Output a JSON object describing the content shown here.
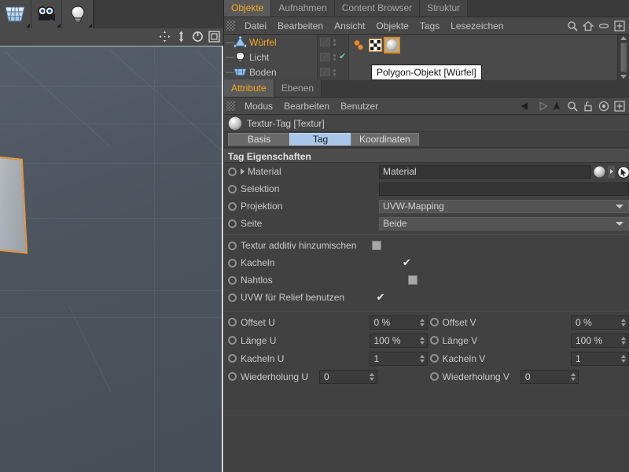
{
  "viewport": {
    "palette": [
      {
        "name": "floor-grid-icon",
        "label": "Boden"
      },
      {
        "name": "camera-icon",
        "label": "Kamera"
      },
      {
        "name": "light-bulb-icon",
        "label": "Licht"
      }
    ],
    "nav_icons": [
      "move-icon",
      "scale-icon",
      "rotate-icon",
      "viewport-maximize-icon"
    ],
    "selected_object": "Würfel"
  },
  "object_manager": {
    "tabs": [
      {
        "label": "Objekte",
        "active": true
      },
      {
        "label": "Aufnahmen",
        "active": false
      },
      {
        "label": "Content Browser",
        "active": false
      },
      {
        "label": "Struktur",
        "active": false
      }
    ],
    "menu": [
      "Datei",
      "Bearbeiten",
      "Ansicht",
      "Objekte",
      "Tags",
      "Lesezeichen"
    ],
    "menu_icons": [
      "search-icon",
      "home-icon",
      "eye-icon",
      "add-box-icon"
    ],
    "objects": [
      {
        "label": "Würfel",
        "icon": "cube-object-icon",
        "selected": true,
        "visible_check": false
      },
      {
        "label": "Licht",
        "icon": "light-object-icon",
        "selected": false,
        "visible_check": true
      },
      {
        "label": "Boden",
        "icon": "floor-object-icon",
        "selected": false,
        "visible_check": false
      }
    ],
    "tags": [
      {
        "name": "phong-tag-icon",
        "selected": false
      },
      {
        "name": "uv-checker-tag-icon",
        "selected": false
      },
      {
        "name": "texture-tag-icon",
        "selected": true
      }
    ],
    "tooltip": "Polygon-Objekt [Würfel]"
  },
  "attribute_manager": {
    "tabs": [
      {
        "label": "Attribute",
        "active": true
      },
      {
        "label": "Ebenen",
        "active": false
      }
    ],
    "menu": [
      "Modus",
      "Bearbeiten",
      "Benutzer"
    ],
    "menu_icons": [
      "back-arrow-icon",
      "forward-arrow-icon",
      "up-arrow-icon",
      "search-icon",
      "lock-icon",
      "target-icon",
      "add-box-icon"
    ],
    "title": "Textur-Tag [Textur]",
    "title_icon": "texture-tag-icon",
    "subtabs": [
      {
        "label": "Basis",
        "active": false
      },
      {
        "label": "Tag",
        "active": true
      },
      {
        "label": "Koordinaten",
        "active": false
      }
    ],
    "section_title": "Tag Eigenschaften",
    "properties": [
      {
        "label": "Material",
        "type": "link",
        "value": "Material",
        "expandable": true
      },
      {
        "label": "Selektion",
        "type": "text",
        "value": ""
      },
      {
        "label": "Projektion",
        "type": "dropdown",
        "value": "UVW-Mapping"
      },
      {
        "label": "Seite",
        "type": "dropdown",
        "value": "Beide"
      }
    ],
    "checkboxes": [
      {
        "label": "Textur additiv hinzumischen",
        "checked": false
      },
      {
        "label": "Kacheln",
        "checked": true
      },
      {
        "label": "Nahtlos",
        "checked": false
      },
      {
        "label": "UVW für Relief benutzen",
        "checked": true
      }
    ],
    "numeric_fields": [
      {
        "label": "Offset U",
        "value": "0 %"
      },
      {
        "label": "Offset V",
        "value": "0 %"
      },
      {
        "label": "Länge U",
        "value": "100 %"
      },
      {
        "label": "Länge V",
        "value": "100 %"
      },
      {
        "label": "Kacheln U",
        "value": "1"
      },
      {
        "label": "Kacheln V",
        "value": "1"
      },
      {
        "label": "Wiederholung U",
        "value": "0"
      },
      {
        "label": "Wiederholung V",
        "value": "0"
      }
    ]
  },
  "colors": {
    "accent_orange": "#f5a623",
    "tab_active_blue": "#a9c6ea",
    "check_green": "#5dd6a0",
    "selection_edge": "#e8963c"
  }
}
